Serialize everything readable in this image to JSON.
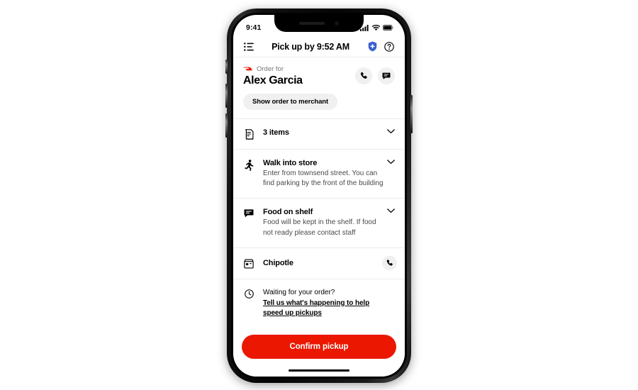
{
  "status_bar": {
    "time": "9:41",
    "icons": [
      "cellular-signal-icon",
      "wifi-icon",
      "battery-icon"
    ]
  },
  "nav_bar": {
    "menu_icon": "list-menu-icon",
    "title": "Pick up by 9:52 AM",
    "shield_icon": "shield-plus-icon",
    "help_icon": "help-circle-icon",
    "shield_color": "#3b5fd1"
  },
  "order_header": {
    "brand_icon": "doordash-logo-icon",
    "order_for_label": "Order for",
    "customer_name": "Alex Garcia",
    "show_order_button": "Show order to merchant",
    "call_icon": "phone-icon",
    "message_icon": "message-icon"
  },
  "rows": [
    {
      "icon": "receipt-icon",
      "title": "3 items",
      "subtitle": "",
      "has_chevron": true
    },
    {
      "icon": "walking-person-icon",
      "title": "Walk into store",
      "subtitle": "Enter from townsend street. You can find parking by the front of the building",
      "has_chevron": true
    },
    {
      "icon": "chat-bubble-icon",
      "title": "Food on shelf",
      "subtitle": "Food will be kept in the shelf. If food not ready please contact staff",
      "has_chevron": true
    }
  ],
  "merchant": {
    "icon": "store-icon",
    "name": "Chipotle",
    "call_icon": "phone-icon"
  },
  "waiting": {
    "icon": "clock-icon",
    "title": "Waiting for your order?",
    "link": "Tell us what's happening to help speed up pickups"
  },
  "footer": {
    "confirm_button": "Confirm pickup",
    "confirm_color": "#eb1700",
    "home_indicator": "home-indicator"
  }
}
